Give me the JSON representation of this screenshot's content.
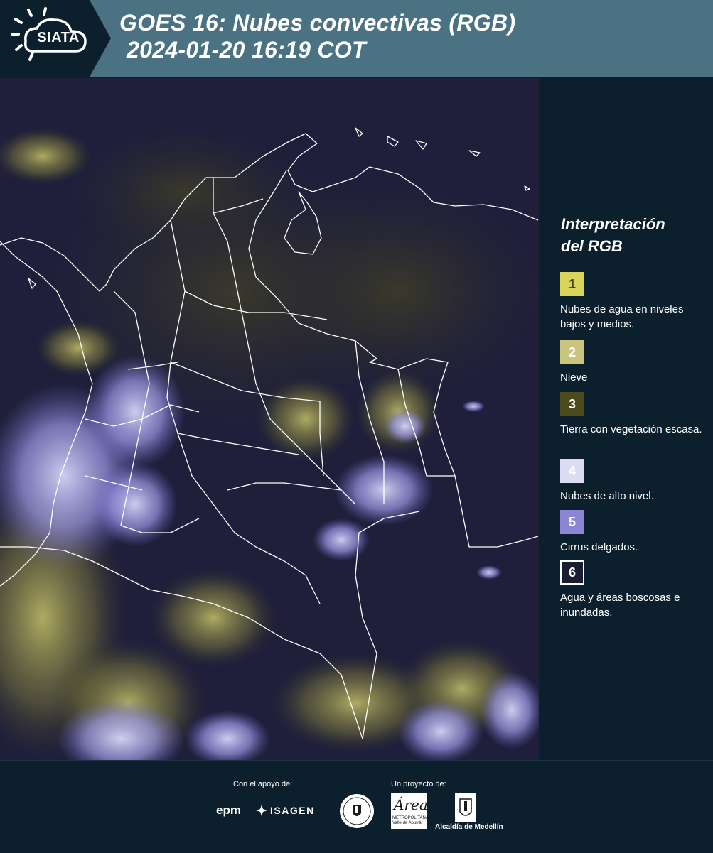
{
  "header": {
    "logo_text": "SIATA",
    "title_line1": "GOES 16: Nubes convectivas (RGB)",
    "title_line2": "2024-01-20 16:19 COT"
  },
  "legend": {
    "title_line1": "Interpretación",
    "title_line2": "del RGB",
    "items": [
      {
        "num": "1",
        "color": "#d8d45a",
        "text_color": "#3a3a10",
        "desc": "Nubes de agua en niveles bajos y medios."
      },
      {
        "num": "2",
        "color": "#c9c47c",
        "text_color": "#ffffff",
        "desc": "Nieve"
      },
      {
        "num": "3",
        "color": "#4b4a1d",
        "text_color": "#ffffff",
        "desc": "Tierra con vegetación escasa."
      },
      {
        "num": "4",
        "color": "#dcdcf3",
        "text_color": "#ffffff",
        "desc": "Nubes de alto nivel."
      },
      {
        "num": "5",
        "color": "#8a86d4",
        "text_color": "#ffffff",
        "desc": "Cirrus delgados."
      },
      {
        "num": "6",
        "color": "#1b1b33",
        "text_color": "#ffffff",
        "desc": "Agua y áreas boscosas e inundadas."
      }
    ]
  },
  "footer": {
    "support_label": "Con el apoyo de:",
    "project_label": "Un proyecto de:",
    "epm": "epm",
    "isagen": "ISAGEN",
    "area_word": "Área",
    "area_sub1": "METROPOLITANA",
    "area_sub2": "Valle de Aburrá",
    "alcaldia": "Alcaldía de Medellín"
  },
  "colors": {
    "header_bg": "#4a7283",
    "logo_bg": "#0c1f2c",
    "page_bg": "#0c1f2c",
    "map_bg": "#1d1d3a"
  },
  "icons": [
    "siata-logo",
    "epm-logo",
    "isagen-logo",
    "medellin-seal",
    "area-metropolitana-logo",
    "alcaldia-logo"
  ]
}
